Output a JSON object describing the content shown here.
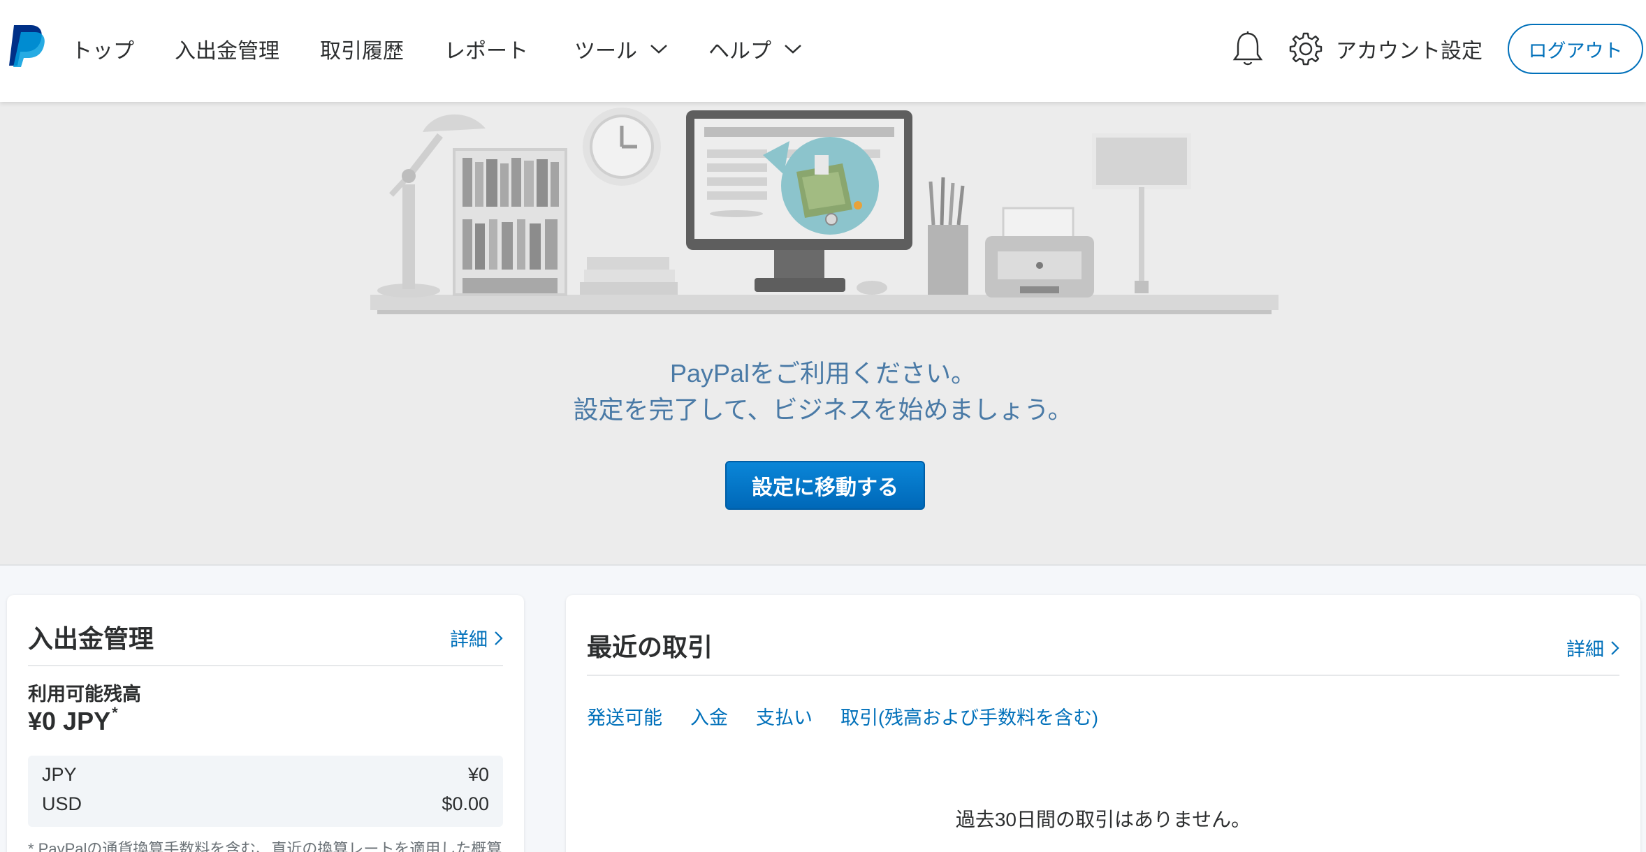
{
  "header": {
    "nav": [
      {
        "label": "トップ"
      },
      {
        "label": "入出金管理"
      },
      {
        "label": "取引履歴"
      },
      {
        "label": "レポート"
      },
      {
        "label": "ツール"
      },
      {
        "label": "ヘルプ"
      }
    ],
    "account_label": "アカウント設定",
    "logout_label": "ログアウト"
  },
  "hero": {
    "line1": "PayPalをご利用ください。",
    "line2": "設定を完了して、ビジネスを始めましょう。",
    "cta_label": "設定に移動する"
  },
  "balance_card": {
    "title": "入出金管理",
    "detail_label": "詳細",
    "available_label": "利用可能残高",
    "total": "¥0 JPY",
    "total_mark": "*",
    "rows": [
      {
        "currency": "JPY",
        "amount": "¥0"
      },
      {
        "currency": "USD",
        "amount": "$0.00"
      }
    ],
    "footnote": "* PayPalの通貨換算手数料を含む、直近の換算レートを適用した概算"
  },
  "recent_card": {
    "title": "最近の取引",
    "detail_label": "詳細",
    "tabs": [
      {
        "label": "発送可能"
      },
      {
        "label": "入金"
      },
      {
        "label": "支払い"
      },
      {
        "label": "取引(残高および手数料を含む)"
      }
    ],
    "empty_message": "過去30日間の取引はありません。"
  },
  "colors": {
    "brand_blue": "#0070ba",
    "hero_text": "#4a7aa6",
    "hero_bg": "#ececec"
  }
}
